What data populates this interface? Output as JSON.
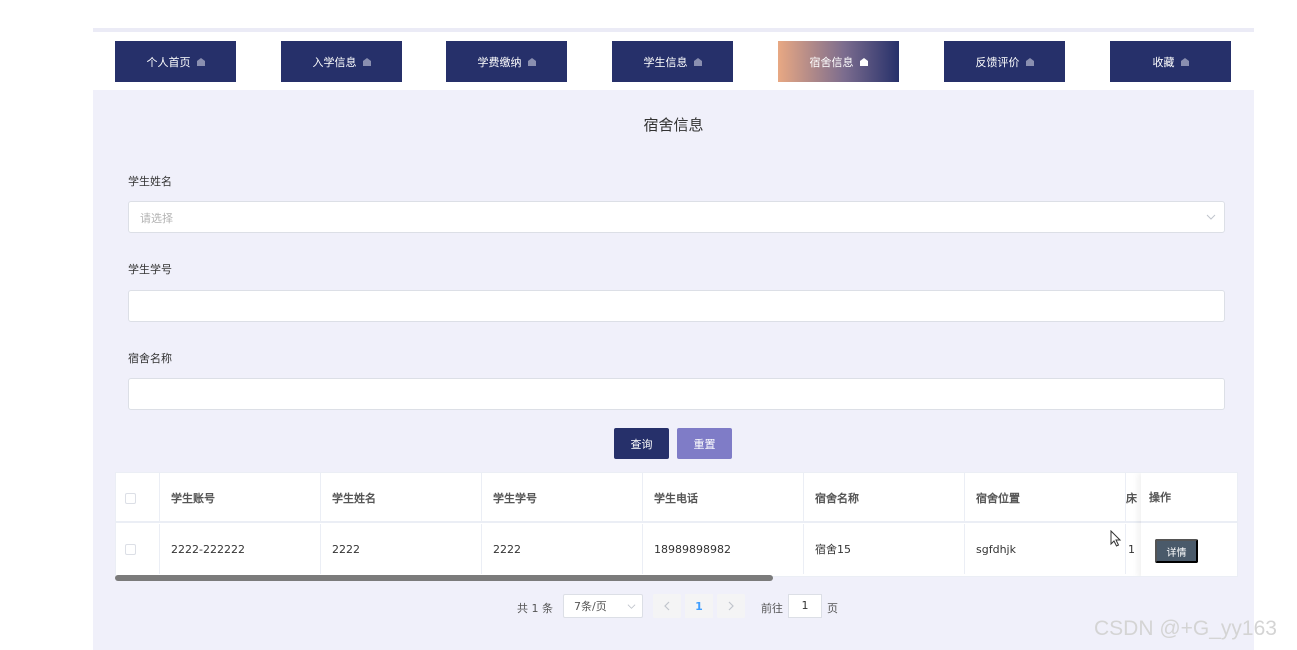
{
  "nav": {
    "items": [
      {
        "label": "个人首页"
      },
      {
        "label": "入学信息"
      },
      {
        "label": "学费缴纳"
      },
      {
        "label": "学生信息"
      },
      {
        "label": "宿舍信息",
        "active": true
      },
      {
        "label": "反馈评价"
      },
      {
        "label": "收藏"
      }
    ]
  },
  "page": {
    "title": "宿舍信息"
  },
  "form": {
    "student_name_label": "学生姓名",
    "student_name_placeholder": "请选择",
    "student_no_label": "学生学号",
    "student_no_value": "",
    "dorm_name_label": "宿舍名称",
    "dorm_name_value": "",
    "query_label": "查询",
    "reset_label": "重置"
  },
  "table": {
    "columns": [
      "学生账号",
      "学生姓名",
      "学生学号",
      "学生电话",
      "宿舍名称",
      "宿舍位置",
      "床",
      "操作"
    ],
    "rows": [
      {
        "account": "2222-222222",
        "name": "2222",
        "student_no": "2222",
        "phone": "18989898982",
        "dorm_name": "宿舍15",
        "dorm_location": "sgfdhjk",
        "bed": "1",
        "action_label": "详情"
      }
    ]
  },
  "pagination": {
    "total_text": "共 1 条",
    "page_size_text": "7条/页",
    "current_page": "1",
    "goto_label": "前往",
    "goto_value": "1",
    "page_unit": "页"
  },
  "watermark": "CSDN @+G_yy163",
  "colors": {
    "nav_bg": "#26306a",
    "accent": "#409eff",
    "reset_btn": "#7f7cc7",
    "panel_bg": "#f0f0fa"
  }
}
